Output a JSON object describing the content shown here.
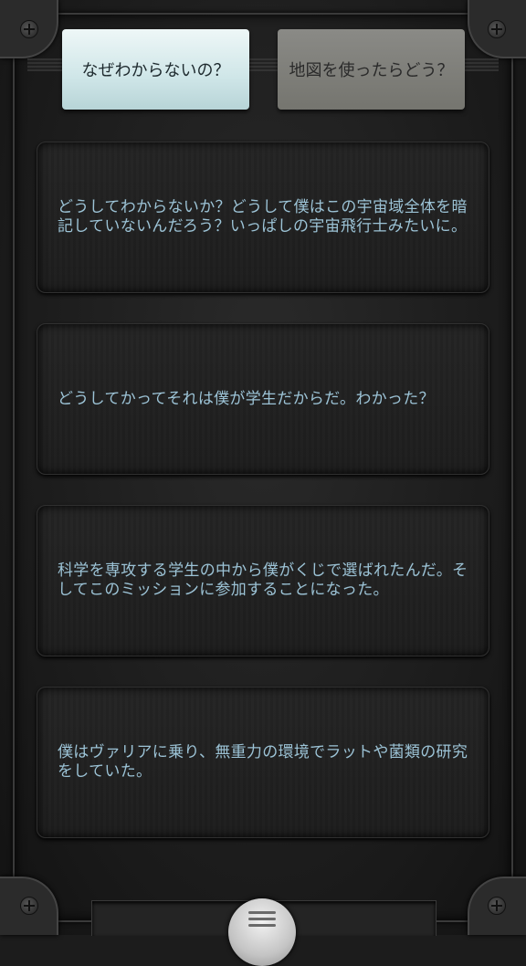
{
  "tabs": [
    {
      "label": "なぜわからないの？",
      "active": true
    },
    {
      "label": "地図を使ったらどう？",
      "active": false
    }
  ],
  "dialog": [
    "どうしてわからないか？どうして僕はこの宇宙域全体を暗記していないんだろう？いっぱしの宇宙飛行士みたいに。",
    "どうしてかってそれは僕が学生だからだ。わかった？",
    "科学を専攻する学生の中から僕がくじで選ばれたんだ。そしてこのミッションに参加することになった。",
    "僕はヴァリアに乗り、無重力の環境でラットや菌類の研究をしていた。"
  ],
  "colors": {
    "text": "#9cc3d6",
    "active_tab": "#cfe6e8",
    "inactive_tab": "#7f7f7a"
  },
  "icons": {
    "menu": "hamburger-icon"
  }
}
